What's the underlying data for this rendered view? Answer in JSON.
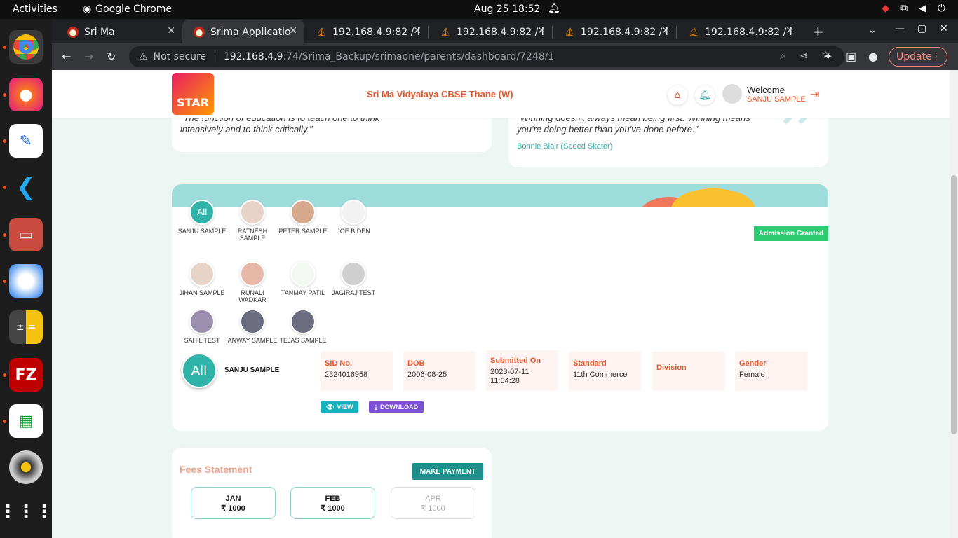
{
  "os": {
    "activities": "Activities",
    "app_name": "Google Chrome",
    "clock": "Aug 25  18:52"
  },
  "tabs": [
    {
      "title": "Sri Ma"
    },
    {
      "title": "Srima Applicatio"
    },
    {
      "title": "192.168.4.9:82 / l"
    },
    {
      "title": "192.168.4.9:82 / l"
    },
    {
      "title": "192.168.4.9:82 / l"
    },
    {
      "title": "192.168.4.9:82 / l"
    }
  ],
  "toolbar": {
    "not_secure": "Not secure",
    "url_host": "192.168.4.9",
    "url_rest": ":74/Srima_Backup/srimaone/parents/dashboard/7248/1",
    "update_label": "Update"
  },
  "header": {
    "logo_text": "STAR",
    "school_name": "Sri Ma Vidyalaya CBSE Thane (W)",
    "welcome": "Welcome",
    "user_name": "SANJU SAMPLE"
  },
  "quotes": {
    "left_text": "\"The function of education is to teach one to think intensively and to think critically.\"",
    "right_text": "\"Winning doesn't always mean being first. Winning means you're doing better than you've done before.\"",
    "right_author": "Bonnie Blair (Speed Skater)"
  },
  "students": {
    "badge": "Admission Granted",
    "list": [
      {
        "name": "SANJU SAMPLE",
        "avatar": "All"
      },
      {
        "name": "RATNESH SAMPLE"
      },
      {
        "name": "PETER SAMPLE"
      },
      {
        "name": "JOE BIDEN"
      },
      {
        "name": "JIHAN SAMPLE"
      },
      {
        "name": "RUNALI WADKAR"
      },
      {
        "name": "TANMAY PATIL"
      },
      {
        "name": "JAGIRAJ TEST"
      },
      {
        "name": "SAHIL TEST"
      },
      {
        "name": "ANWAY SAMPLE"
      },
      {
        "name": "TEJAS SAMPLE"
      }
    ],
    "selected": {
      "avatar": "All",
      "name": "SANJU SAMPLE",
      "fields": [
        {
          "label": "SID No.",
          "value": "2324016958"
        },
        {
          "label": "DOB",
          "value": "2006-08-25"
        },
        {
          "label": "Submitted On",
          "value": "2023-07-11 11:54:28"
        },
        {
          "label": "Standard",
          "value": "11th Commerce"
        },
        {
          "label": "Division",
          "value": ""
        },
        {
          "label": "Gender",
          "value": "Female"
        }
      ],
      "view_label": "VIEW",
      "download_label": "DOWNLOAD"
    }
  },
  "fees": {
    "title": "Fees Statement",
    "pay_label": "MAKE PAYMENT",
    "months": [
      {
        "month": "JAN",
        "amount": "₹ 1000"
      },
      {
        "month": "FEB",
        "amount": "₹ 1000"
      },
      {
        "month": "APR",
        "amount": "₹ 1000"
      }
    ]
  },
  "colors": {
    "accent": "#e4572e",
    "teal": "#2fb3a9",
    "badge_green": "#2ecc71",
    "download_purple": "#7b4fd6"
  }
}
